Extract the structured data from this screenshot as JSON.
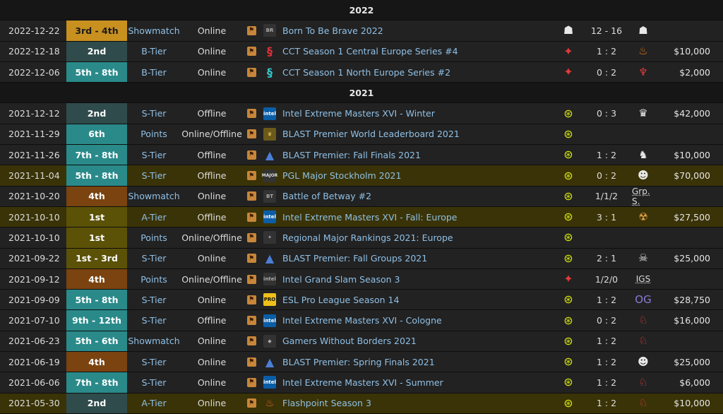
{
  "rows": [
    {
      "kind": "year",
      "year": "2022"
    },
    {
      "kind": "event",
      "date": "2022-12-22",
      "place": "3rd - 4th",
      "placeClass": "place-gold",
      "tier": "Showmatch",
      "type": "Online",
      "logo": "bravo",
      "name": "Born To Be Brave 2022",
      "team": "cs-soldier-icon",
      "score": "12 - 16",
      "opp": "cs-soldier-icon",
      "oppText": "",
      "prize": "",
      "major": false
    },
    {
      "kind": "event",
      "date": "2022-12-18",
      "place": "2nd",
      "placeClass": "place-silver",
      "tier": "B-Tier",
      "type": "Online",
      "logo": "cct-red",
      "name": "CCT Season 1 Central Europe Series #4",
      "team": "red-arrow-icon",
      "score": "1 : 2",
      "opp": "flame-icon",
      "oppText": "",
      "prize": "$10,000",
      "major": false
    },
    {
      "kind": "event",
      "date": "2022-12-06",
      "place": "5th - 8th",
      "placeClass": "place-teal",
      "tier": "B-Tier",
      "type": "Online",
      "logo": "cct-teal",
      "name": "CCT Season 1 North Europe Series #2",
      "team": "red-arrow-icon",
      "score": "0 : 2",
      "opp": "red-beast-icon",
      "oppText": "",
      "prize": "$2,000",
      "major": false
    },
    {
      "kind": "year",
      "year": "2021"
    },
    {
      "kind": "event",
      "date": "2021-12-12",
      "place": "2nd",
      "placeClass": "place-silver",
      "tier": "S-Tier",
      "type": "Offline",
      "logo": "iem",
      "name": "Intel Extreme Masters XVI - Winter",
      "team": "navi-icon",
      "score": "0 : 3",
      "opp": "vitality-icon",
      "oppText": "",
      "prize": "$42,000",
      "major": false
    },
    {
      "kind": "event",
      "date": "2021-11-29",
      "place": "6th",
      "placeClass": "place-teal",
      "tier": "Points",
      "type": "Online/Offline",
      "logo": "blast-trophy",
      "name": "BLAST Premier World Leaderboard 2021",
      "team": "navi-icon",
      "score": "",
      "opp": "",
      "oppText": "",
      "prize": "",
      "major": false
    },
    {
      "kind": "event",
      "date": "2021-11-26",
      "place": "7th - 8th",
      "placeClass": "place-teal",
      "tier": "S-Tier",
      "type": "Offline",
      "logo": "blast",
      "name": "BLAST Premier: Fall Finals 2021",
      "team": "navi-icon",
      "score": "1 : 2",
      "opp": "liquid-icon",
      "oppText": "",
      "prize": "$10,000",
      "major": false
    },
    {
      "kind": "event",
      "date": "2021-11-04",
      "place": "5th - 8th",
      "placeClass": "place-teal",
      "tier": "S-Tier",
      "type": "Offline",
      "logo": "pgl",
      "name": "PGL Major Stockholm 2021",
      "team": "navi-icon",
      "score": "0 : 2",
      "opp": "g2-icon",
      "oppText": "",
      "prize": "$70,000",
      "major": true
    },
    {
      "kind": "event",
      "date": "2021-10-20",
      "place": "4th",
      "placeClass": "place-bronze",
      "tier": "Showmatch",
      "type": "Online",
      "logo": "betway",
      "name": "Battle of Betway #2",
      "team": "navi-icon",
      "score": "1/1/2",
      "opp": "",
      "oppText": "Grp. S.",
      "prize": "",
      "major": false
    },
    {
      "kind": "event",
      "date": "2021-10-10",
      "place": "1st",
      "placeClass": "place-olive",
      "tier": "A-Tier",
      "type": "Offline",
      "logo": "iem",
      "name": "Intel Extreme Masters XVI - Fall: Europe",
      "team": "navi-icon",
      "score": "3 : 1",
      "opp": "ence-icon",
      "oppText": "",
      "prize": "$27,500",
      "major": true
    },
    {
      "kind": "event",
      "date": "2021-10-10",
      "place": "1st",
      "placeClass": "place-olive",
      "tier": "Points",
      "type": "Online/Offline",
      "logo": "rmr",
      "name": "Regional Major Rankings 2021: Europe",
      "team": "navi-icon",
      "score": "",
      "opp": "",
      "oppText": "",
      "prize": "",
      "major": false
    },
    {
      "kind": "event",
      "date": "2021-09-22",
      "place": "1st - 3rd",
      "placeClass": "place-olive",
      "tier": "S-Tier",
      "type": "Online",
      "logo": "blast",
      "name": "BLAST Premier: Fall Groups 2021",
      "team": "navi-icon",
      "score": "2 : 1",
      "opp": "big-icon",
      "oppText": "",
      "prize": "$25,000",
      "major": false
    },
    {
      "kind": "event",
      "date": "2021-09-12",
      "place": "4th",
      "placeClass": "place-bronze",
      "tier": "Points",
      "type": "Online/Offline",
      "logo": "intel",
      "name": "Intel Grand Slam Season 3",
      "team": "red-arrow-icon",
      "score": "1/2/0",
      "opp": "",
      "oppText": "IGS",
      "prize": "",
      "major": false
    },
    {
      "kind": "event",
      "date": "2021-09-09",
      "place": "5th - 8th",
      "placeClass": "place-teal",
      "tier": "S-Tier",
      "type": "Online",
      "logo": "epl",
      "name": "ESL Pro League Season 14",
      "team": "navi-icon",
      "score": "1 : 2",
      "opp": "og-icon",
      "oppText": "",
      "prize": "$28,750",
      "major": false
    },
    {
      "kind": "event",
      "date": "2021-07-10",
      "place": "9th - 12th",
      "placeClass": "place-teal",
      "tier": "S-Tier",
      "type": "Offline",
      "logo": "iem",
      "name": "Intel Extreme Masters XVI - Cologne",
      "team": "navi-icon",
      "score": "0 : 2",
      "opp": "virtus-pro-icon",
      "oppText": "",
      "prize": "$16,000",
      "major": false
    },
    {
      "kind": "event",
      "date": "2021-06-23",
      "place": "5th - 6th",
      "placeClass": "place-teal",
      "tier": "Showmatch",
      "type": "Online",
      "logo": "gwb",
      "name": "Gamers Without Borders 2021",
      "team": "navi-icon",
      "score": "1 : 2",
      "opp": "mousesports-icon",
      "oppText": "",
      "prize": "",
      "major": false
    },
    {
      "kind": "event",
      "date": "2021-06-19",
      "place": "4th",
      "placeClass": "place-bronze",
      "tier": "S-Tier",
      "type": "Online",
      "logo": "blast-gold",
      "name": "BLAST Premier: Spring Finals 2021",
      "team": "navi-icon",
      "score": "1 : 2",
      "opp": "g2-icon",
      "oppText": "",
      "prize": "$25,000",
      "major": false
    },
    {
      "kind": "event",
      "date": "2021-06-06",
      "place": "7th - 8th",
      "placeClass": "place-teal",
      "tier": "S-Tier",
      "type": "Online",
      "logo": "iem",
      "name": "Intel Extreme Masters XVI - Summer",
      "team": "navi-icon",
      "score": "1 : 2",
      "opp": "virtus-pro-icon",
      "oppText": "",
      "prize": "$6,000",
      "major": false
    },
    {
      "kind": "event",
      "date": "2021-05-30",
      "place": "2nd",
      "placeClass": "place-silver",
      "tier": "A-Tier",
      "type": "Online",
      "logo": "flashpoint",
      "name": "Flashpoint Season 3",
      "team": "navi-icon",
      "score": "1 : 2",
      "opp": "mousesports-icon",
      "oppText": "",
      "prize": "$10,000",
      "major": true
    }
  ]
}
